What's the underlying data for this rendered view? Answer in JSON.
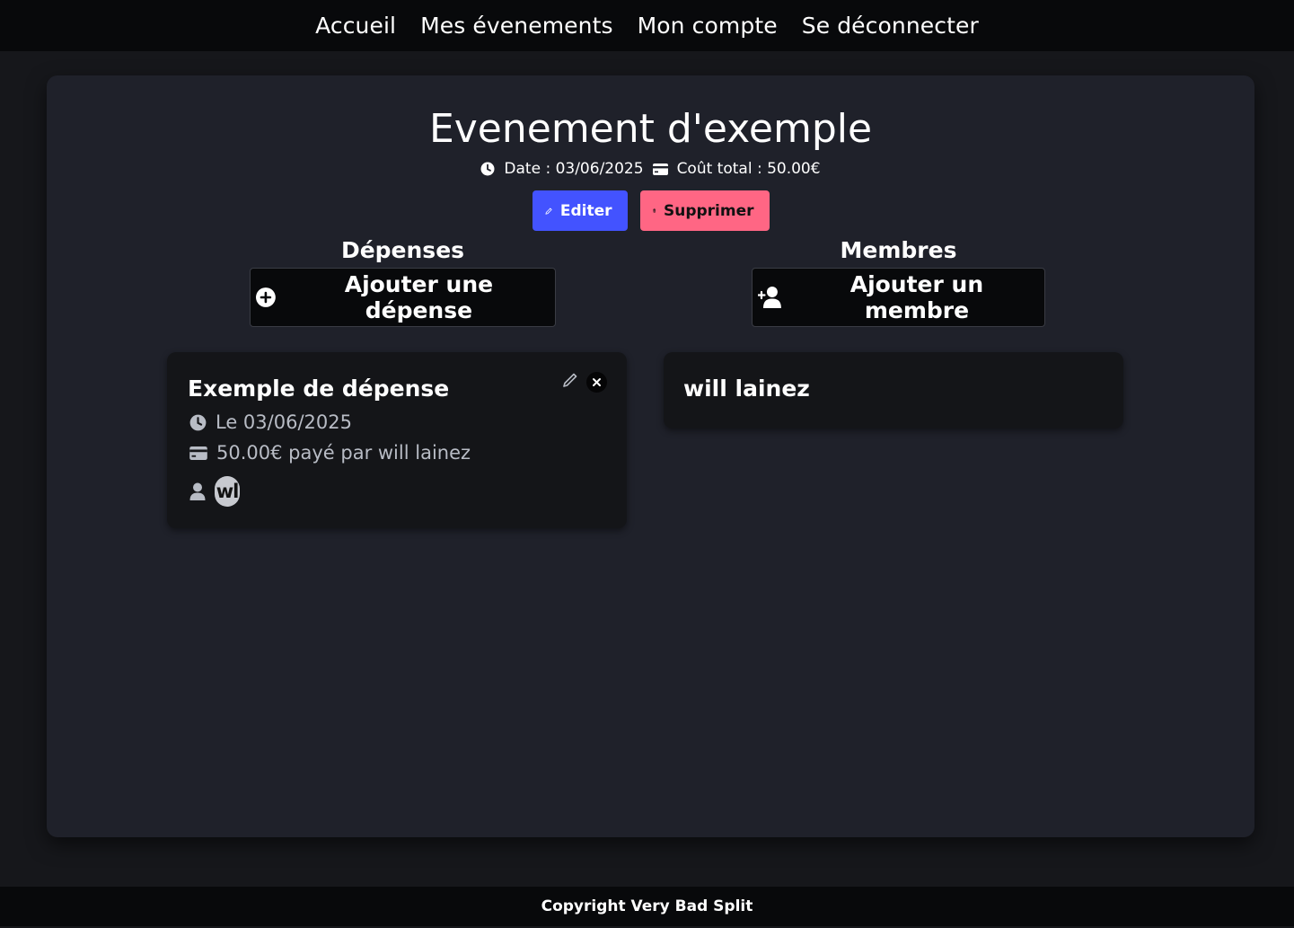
{
  "nav": {
    "home": "Accueil",
    "events": "Mes évenements",
    "account": "Mon compte",
    "logout": "Se déconnecter"
  },
  "event": {
    "title": "Evenement d'exemple",
    "date_text": "Date : 03/06/2025",
    "total_text": "Coût total : 50.00€",
    "edit_label": "Editer",
    "delete_label": "Supprimer"
  },
  "expenses": {
    "heading": "Dépenses",
    "add_label": "Ajouter une dépense",
    "items": [
      {
        "title": "Exemple de dépense",
        "date_text": "Le 03/06/2025",
        "amount_text": "50.00€ payé par will lainez",
        "participant_initials": "wl"
      }
    ]
  },
  "members": {
    "heading": "Membres",
    "add_label": "Ajouter un membre",
    "items": [
      {
        "name": "will lainez"
      }
    ]
  },
  "footer": {
    "copyright": "Copyright Very Bad Split"
  },
  "icons": {
    "date": "clock-icon",
    "total": "credit-card-icon",
    "edit": "pencil-icon",
    "delete": "trash-icon",
    "add_expense": "plus-circle-icon",
    "add_member": "user-plus-icon",
    "participant": "user-icon",
    "close": "close-icon"
  },
  "colors": {
    "edit_button": "#4353ff",
    "delete_button": "#ff6684",
    "card_background": "#1f212a",
    "panel_background": "#141518"
  }
}
